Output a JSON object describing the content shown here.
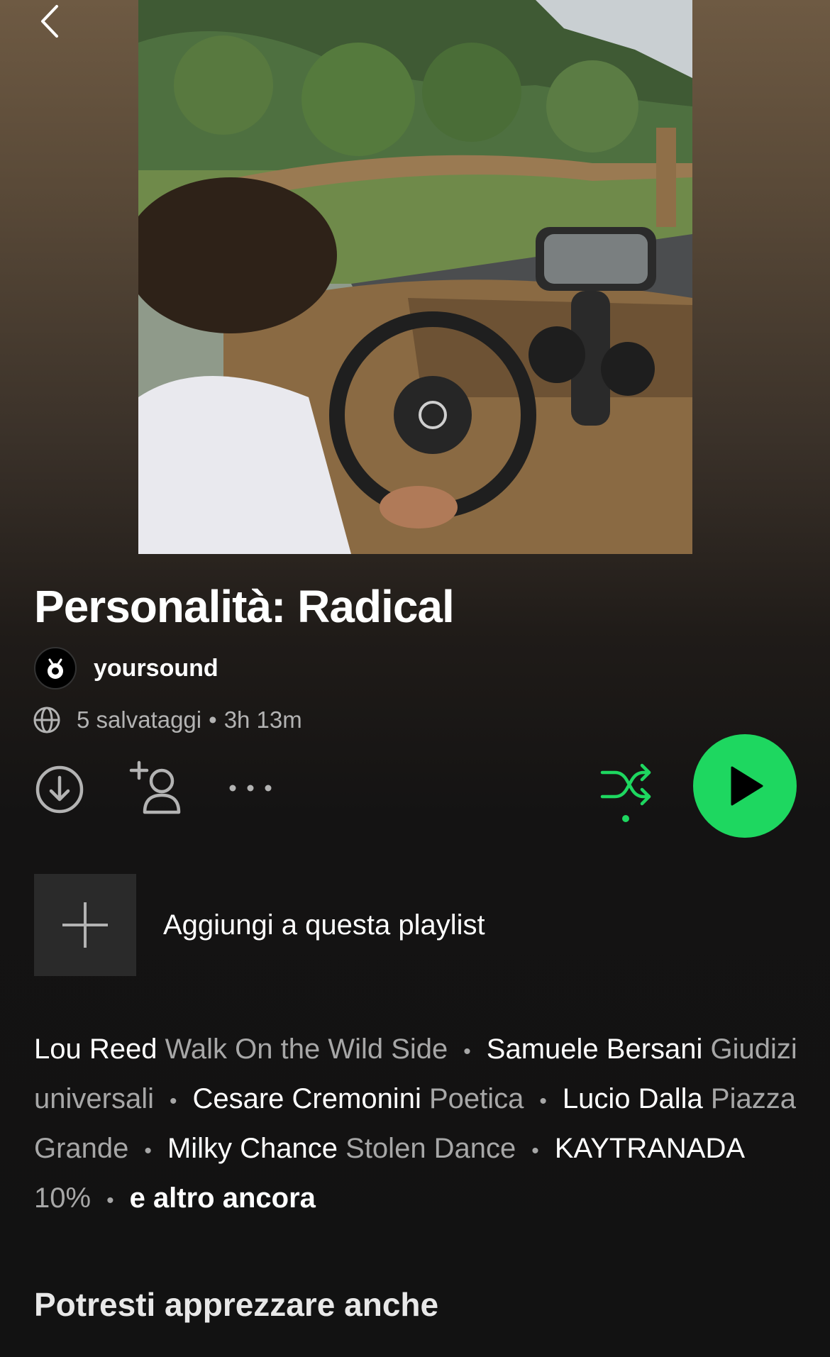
{
  "playlist": {
    "title": "Personalità: Radical",
    "owner": "yoursound",
    "saves": "5 salvataggi",
    "separator": "•",
    "duration": "3h 13m"
  },
  "actions": {
    "download_icon": "download-circle-icon",
    "add_user_icon": "add-user-icon",
    "more_icon": "more-horizontal-icon",
    "shuffle_icon": "shuffle-icon",
    "play_icon": "play-icon",
    "accent": "#1ed760"
  },
  "add_to_playlist": {
    "label": "Aggiungi a questa playlist",
    "icon": "plus-icon"
  },
  "tracks": [
    {
      "artist": "Lou Reed",
      "song": "Walk On the Wild Side"
    },
    {
      "artist": "Samuele Bersani",
      "song": "Giudizi universali"
    },
    {
      "artist": "Cesare Cremonini",
      "song": "Poetica"
    },
    {
      "artist": "Lucio Dalla",
      "song": "Piazza Grande"
    },
    {
      "artist": "Milky Chance",
      "song": "Stolen Dance"
    },
    {
      "artist": "KAYTRANADA",
      "song": "10%"
    }
  ],
  "more_label": "e altro ancora",
  "recommend_title": "Potresti apprezzare anche"
}
